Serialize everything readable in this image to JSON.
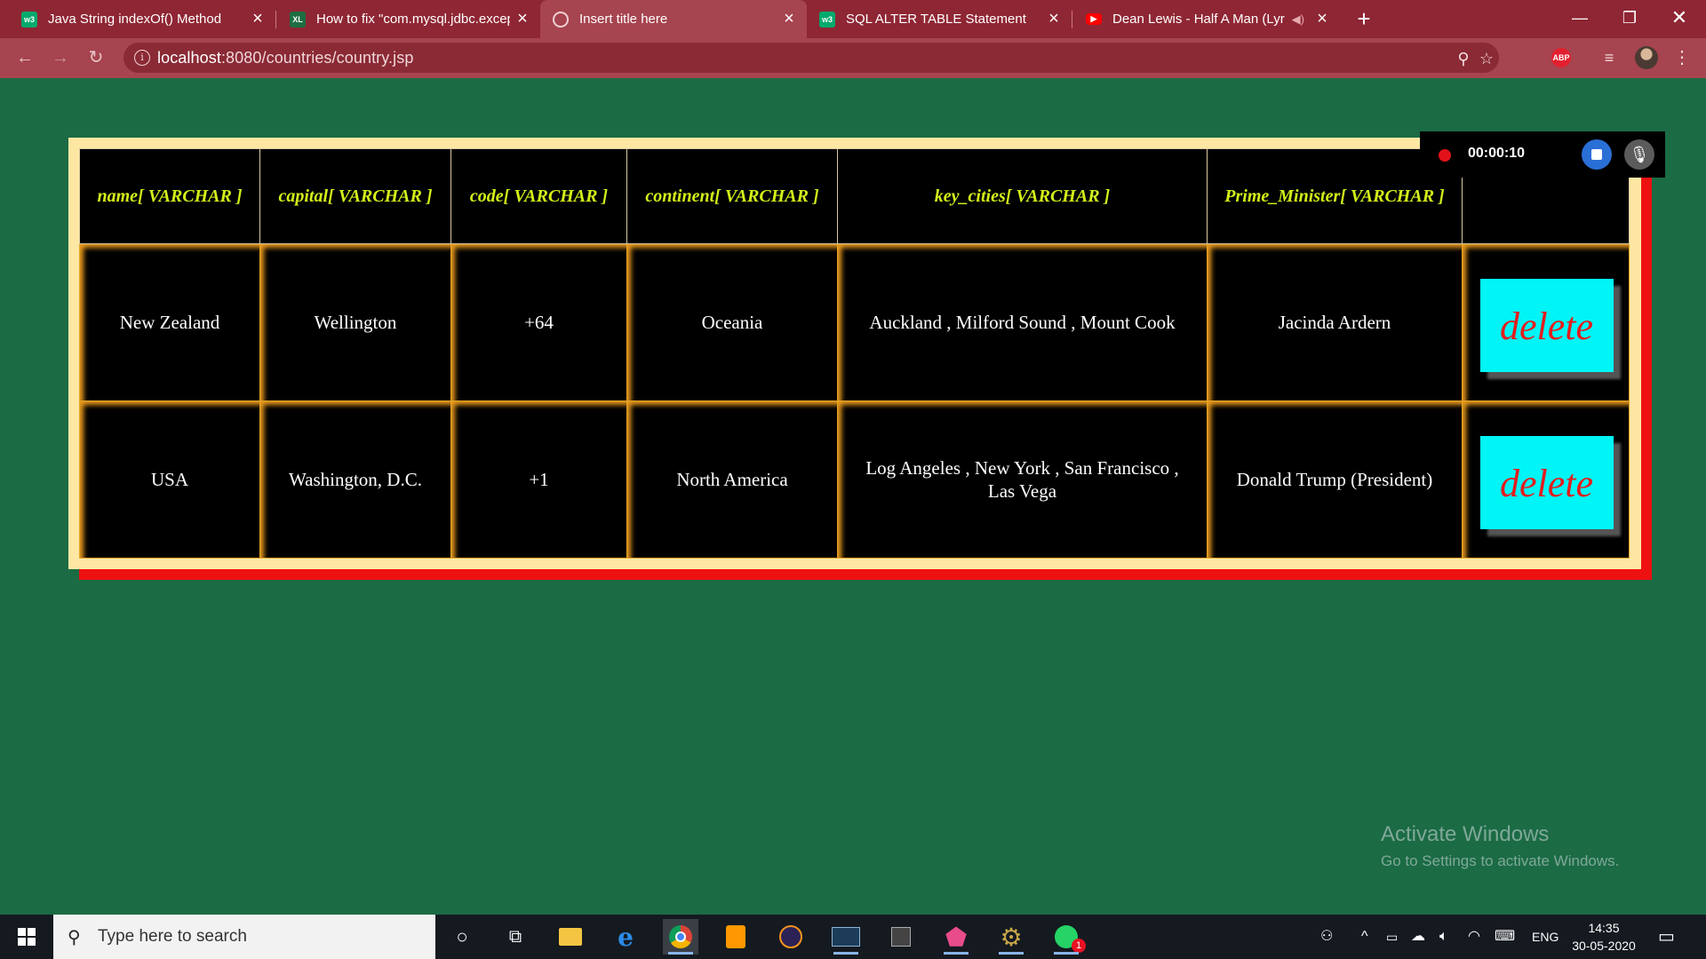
{
  "browser": {
    "tabs": [
      {
        "title": "Java String indexOf() Method",
        "icon": "w3schools-icon",
        "color": "#04aa6d",
        "favtext": "w3"
      },
      {
        "title": "How to fix \"com.mysql.jdbc.excep",
        "icon": "excel-icon",
        "color": "#1d6f42",
        "favtext": "XL"
      },
      {
        "title": "Insert title here",
        "icon": "globe-icon",
        "color": "#7a5a5f",
        "favtext": ""
      },
      {
        "title": "SQL ALTER TABLE Statement",
        "icon": "w3schools-icon",
        "color": "#04aa6d",
        "favtext": "w3"
      },
      {
        "title": "Dean Lewis - Half A Man (Lyr",
        "icon": "youtube-icon",
        "color": "#ff0000",
        "favtext": "▶"
      }
    ],
    "active_tab": 2,
    "url_host": "localhost",
    "url_path": ":8080/countries/country.jsp"
  },
  "table": {
    "headers": [
      "name[ VARCHAR ]",
      "capital[ VARCHAR ]",
      "code[ VARCHAR ]",
      "continent[ VARCHAR ]",
      "key_cities[ VARCHAR ]",
      "Prime_Minister[ VARCHAR ]",
      ""
    ],
    "rows": [
      {
        "name": "New Zealand",
        "capital": "Wellington",
        "code": "+64",
        "continent": "Oceania",
        "key_cities": "Auckland , Milford Sound , Mount Cook",
        "prime_minister": "Jacinda Ardern",
        "action": "delete"
      },
      {
        "name": "USA",
        "capital": "Washington, D.C.",
        "code": "+1",
        "continent": "North America",
        "key_cities": "Log Angeles , New York , San Francisco , Las Vega",
        "prime_minister": "Donald Trump (President)",
        "action": "delete"
      }
    ]
  },
  "recorder": {
    "time": "00:00:10"
  },
  "watermark": {
    "line1": "Activate Windows",
    "line2": "Go to Settings to activate Windows."
  },
  "taskbar": {
    "search_placeholder": "Type here to search",
    "time": "14:35",
    "date": "30-05-2020",
    "lang": "ENG",
    "whatsapp_badge": "1"
  }
}
